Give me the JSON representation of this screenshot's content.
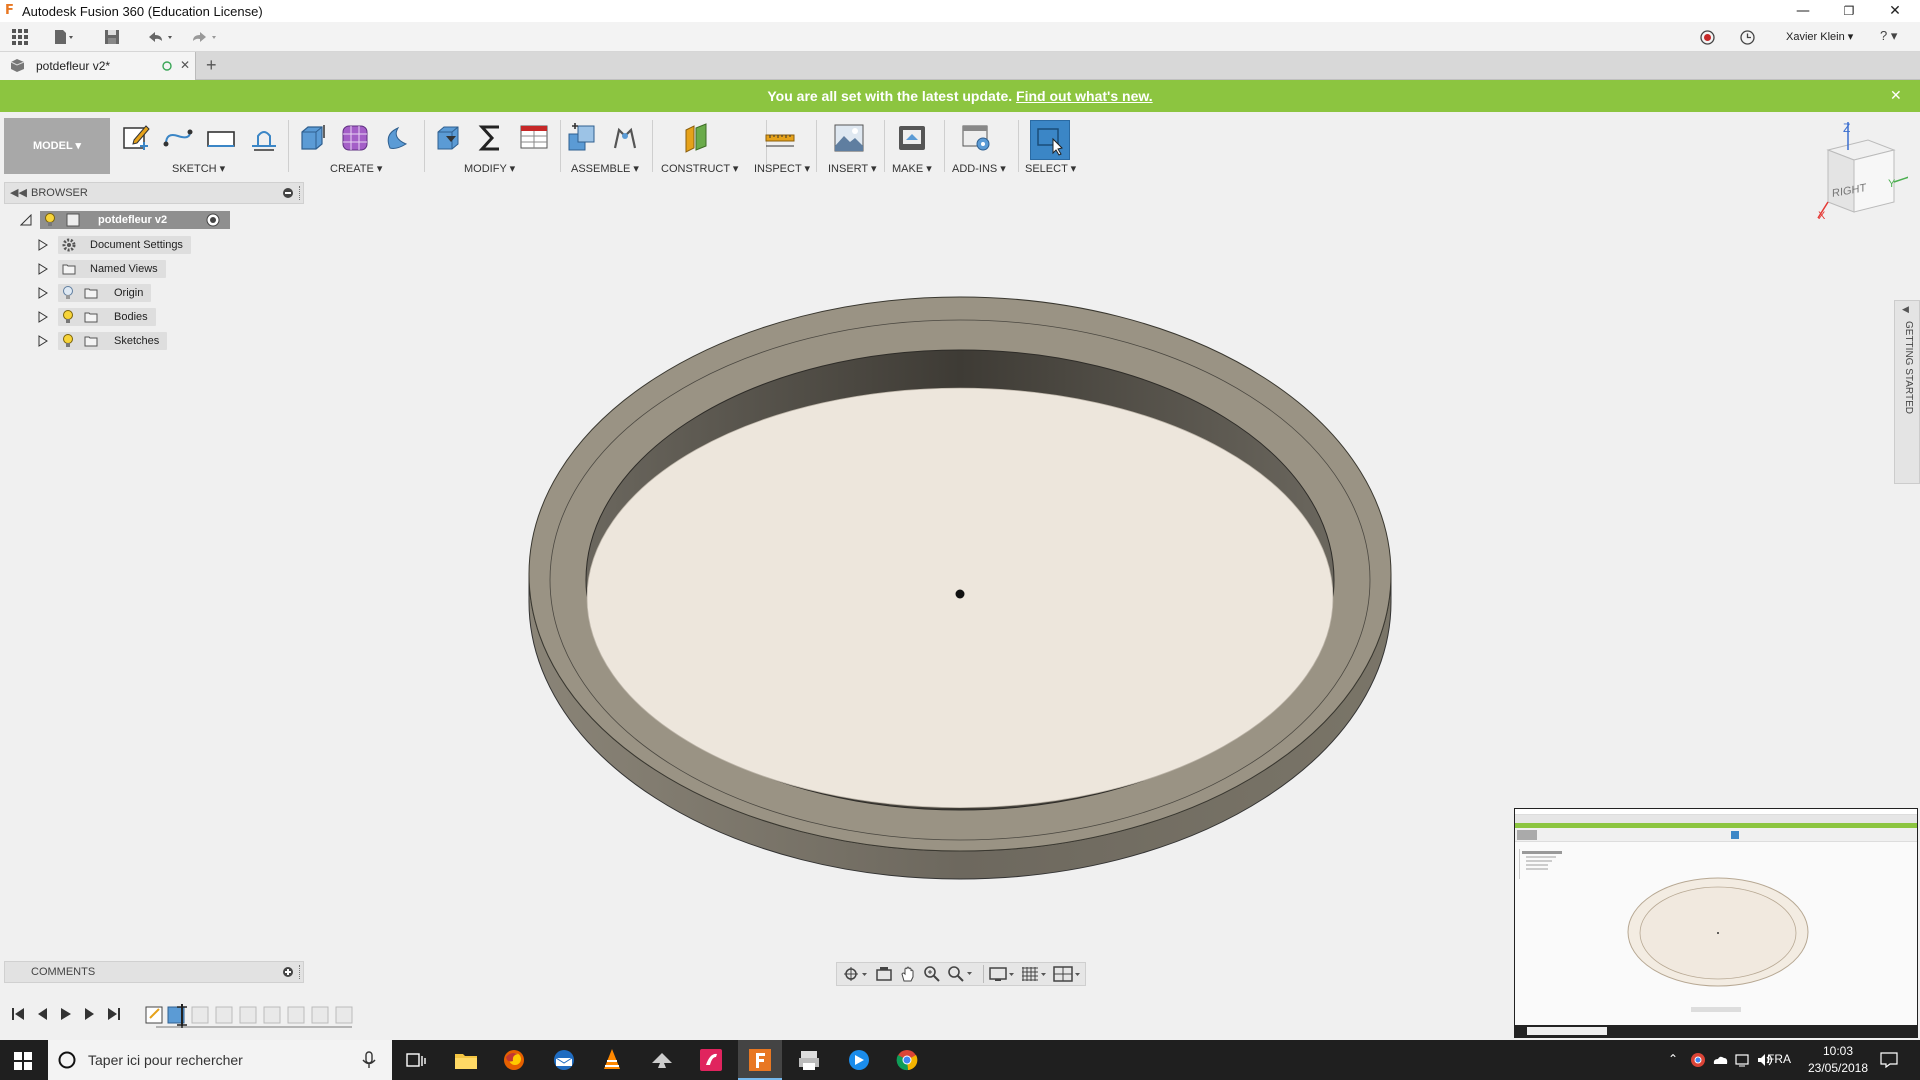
{
  "window": {
    "title": "Autodesk Fusion 360 (Education License)",
    "minimize": "—",
    "maximize": "❐",
    "close": "✕"
  },
  "header": {
    "user": "Xavier Klein ▾",
    "help": "? ▾"
  },
  "tab": {
    "name": "potdefleur v2*",
    "close": "✕",
    "new_tab": "+"
  },
  "banner": {
    "text": "You are all set with the latest update. ",
    "link": "Find out what's new.",
    "close": "✕"
  },
  "toolbar": {
    "workspace": "MODEL ▾",
    "groups": [
      {
        "label": "SKETCH ▾"
      },
      {
        "label": "CREATE ▾"
      },
      {
        "label": "MODIFY ▾"
      },
      {
        "label": "ASSEMBLE ▾"
      },
      {
        "label": "CONSTRUCT ▾"
      },
      {
        "label": "INSPECT ▾"
      },
      {
        "label": "INSERT ▾"
      },
      {
        "label": "MAKE ▾"
      },
      {
        "label": "ADD-INS ▾"
      },
      {
        "label": "SELECT ▾"
      }
    ],
    "accent": "#3b86c6"
  },
  "browser": {
    "title": "BROWSER",
    "root": "potdefleur v2",
    "items": [
      {
        "label": "Document Settings",
        "icon": "gear-icon"
      },
      {
        "label": "Named Views",
        "icon": "folder-icon"
      },
      {
        "label": "Origin",
        "icon": "folder-icon"
      },
      {
        "label": "Bodies",
        "icon": "folder-icon"
      },
      {
        "label": "Sketches",
        "icon": "folder-icon"
      }
    ]
  },
  "comments": {
    "title": "COMMENTS"
  },
  "viewcube": {
    "face": "RIGHT",
    "axis_z": "Z",
    "axis_y": "Y",
    "axis_x": "X"
  },
  "side_panel": {
    "label": "GETTING STARTED"
  },
  "taskbar": {
    "search_placeholder": "Taper ici pour rechercher",
    "language": "FRA",
    "time": "10:03",
    "date": "23/05/2018"
  },
  "colors": {
    "banner": "#8cc540",
    "body_top": "#9a9384",
    "body_side": "#6e6a60",
    "floor": "#ede6dc"
  }
}
